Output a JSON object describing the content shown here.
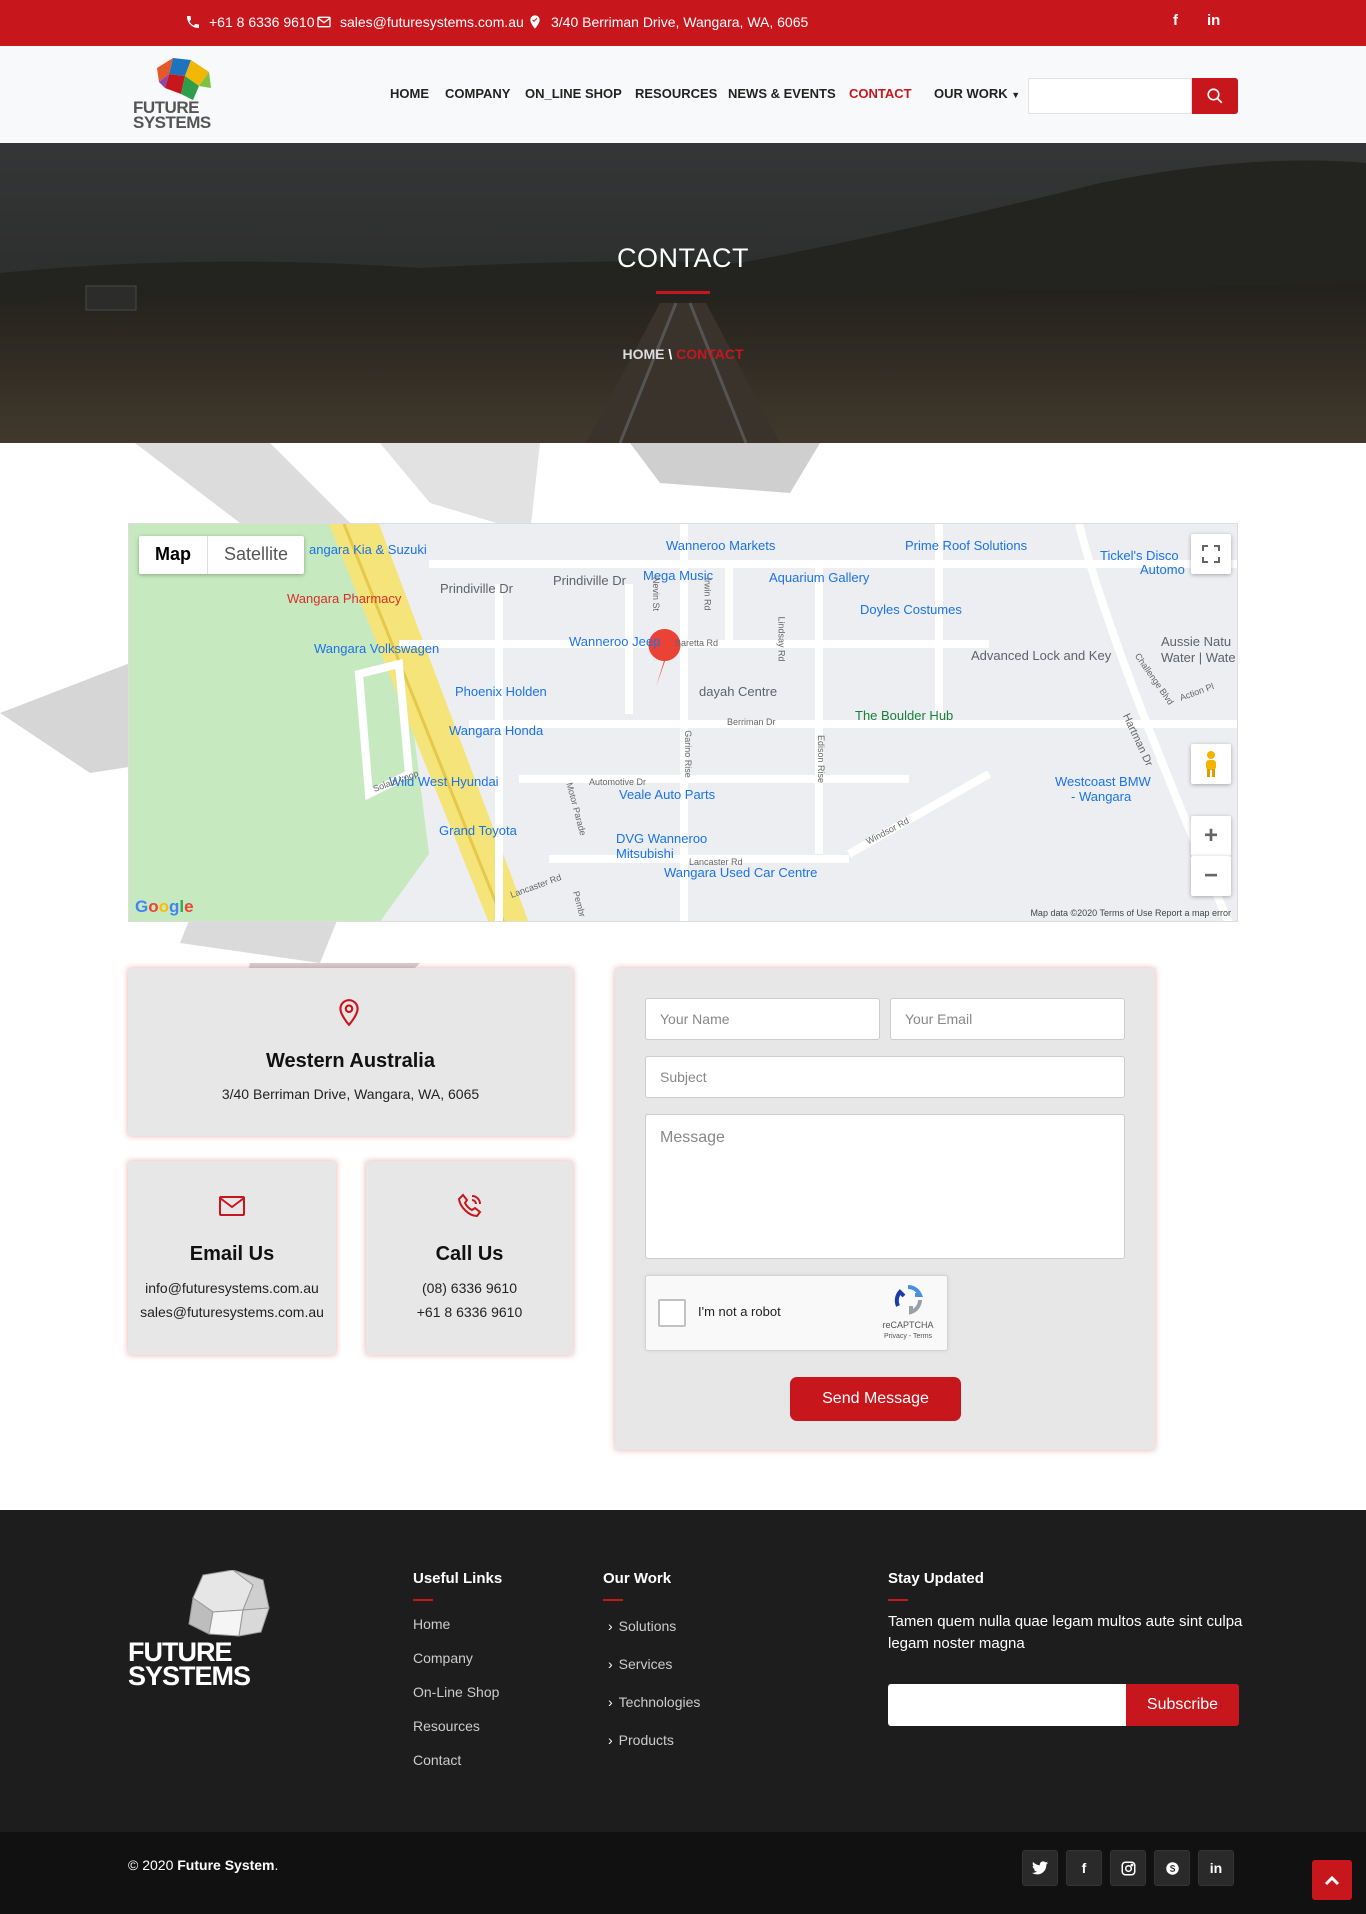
{
  "topbar": {
    "phone": "+61 8 6336 9610",
    "email": "sales@futuresystems.com.au",
    "address": "3/40 Berriman Drive, Wangara, WA, 6065",
    "social": [
      "f",
      "in"
    ]
  },
  "header": {
    "logo_line1": "FUTURE",
    "logo_line2": "SYSTEMS",
    "nav": [
      "HOME",
      "COMPANY",
      "ON_LINE SHOP",
      "RESOURCES",
      "NEWS & EVENTS",
      "CONTACT",
      "OUR WORK"
    ],
    "active_nav": "CONTACT",
    "search_placeholder": ""
  },
  "hero": {
    "title": "CONTACT",
    "crumb_home": "HOME",
    "crumb_sep": "\\",
    "crumb_current": "CONTACT"
  },
  "map": {
    "toggle_map": "Map",
    "toggle_satellite": "Satellite",
    "pois": [
      {
        "label": "angara Kia & Suzuki",
        "color": "blue"
      },
      {
        "label": "Wanneroo Markets",
        "color": "blue"
      },
      {
        "label": "Prime Roof Solutions",
        "color": "blue"
      },
      {
        "label": "Tickel's Disco",
        "color": "blue"
      },
      {
        "label": "Automo",
        "color": "blue"
      },
      {
        "label": "Wangara Pharmacy",
        "color": "red"
      },
      {
        "label": "Prindiville Dr",
        "color": "gray"
      },
      {
        "label": "Prindiville Dr",
        "color": "gray"
      },
      {
        "label": "Mega Music",
        "color": "blue"
      },
      {
        "label": "Aquarium Gallery",
        "color": "blue"
      },
      {
        "label": "Doyles Costumes",
        "color": "blue"
      },
      {
        "label": "Wangara Volkswagen",
        "color": "blue"
      },
      {
        "label": "Wanneroo Jeep",
        "color": "blue"
      },
      {
        "label": "Aussie Natu",
        "color": "gray"
      },
      {
        "label": "Water | Wate",
        "color": "gray"
      },
      {
        "label": "Advanced Lock and Key",
        "color": "gray"
      },
      {
        "label": "Phoenix Holden",
        "color": "blue"
      },
      {
        "label": "dayah Centre",
        "color": "gray"
      },
      {
        "label": "The Boulder Hub",
        "color": "green"
      },
      {
        "label": "Wangara Honda",
        "color": "blue"
      },
      {
        "label": "Wild West Hyundai",
        "color": "blue"
      },
      {
        "label": "Veale Auto Parts",
        "color": "blue"
      },
      {
        "label": "Westcoast BMW",
        "color": "blue"
      },
      {
        "label": "- Wangara",
        "color": "blue"
      },
      {
        "label": "Grand Toyota",
        "color": "blue"
      },
      {
        "label": "DVG Wanneroo",
        "color": "blue"
      },
      {
        "label": "Mitsubishi",
        "color": "blue"
      },
      {
        "label": "Wangara Used Car Centre",
        "color": "blue"
      }
    ],
    "streets": [
      "Baretta Rd",
      "Berriman Dr",
      "Automotive Dr",
      "Lancaster Rd",
      "Windsor Rd",
      "Solaia Loop",
      "Motor Parade",
      "Garino Rise",
      "Edison Rise",
      "Lindsay Rd",
      "Nevin St",
      "Irwin Rd",
      "Hartman Dr",
      "Challenge Blvd",
      "Action Pl",
      "Lancaster Rd",
      "Pembr"
    ],
    "footer_text": "Map data ©2020    Terms of Use    Report a map error",
    "google": "Google"
  },
  "cards": {
    "wa_title": "Western Australia",
    "wa_address": "3/40 Berriman Drive, Wangara, WA, 6065",
    "email_title": "Email Us",
    "email_1": "info@futuresystems.com.au",
    "email_2": "sales@futuresystems.com.au",
    "call_title": "Call Us",
    "call_1": "(08) 6336 9610",
    "call_2": "+61 8 6336 9610"
  },
  "form": {
    "name_placeholder": "Your Name",
    "email_placeholder": "Your Email",
    "subject_placeholder": "Subject",
    "message_placeholder": "Message",
    "captcha_label": "I'm not a robot",
    "captcha_brand": "reCAPTCHA",
    "captcha_links": "Privacy - Terms",
    "send_label": "Send Message"
  },
  "footer": {
    "logo_line1": "FUTURE",
    "logo_line2": "SYSTEMS",
    "useful_title": "Useful Links",
    "useful_links": [
      "Home",
      "Company",
      "On-Line Shop",
      "Resources",
      "Contact"
    ],
    "work_title": "Our Work",
    "work_links": [
      "Solutions",
      "Services",
      "Technologies",
      "Products"
    ],
    "stay_title": "Stay Updated",
    "stay_text": "Tamen quem nulla quae legam multos aute sint culpa legam noster magna",
    "subscribe_label": "Subscribe",
    "copyright_prefix": "© 2020 ",
    "copyright_brand": "Future System",
    "copyright_suffix": "."
  }
}
